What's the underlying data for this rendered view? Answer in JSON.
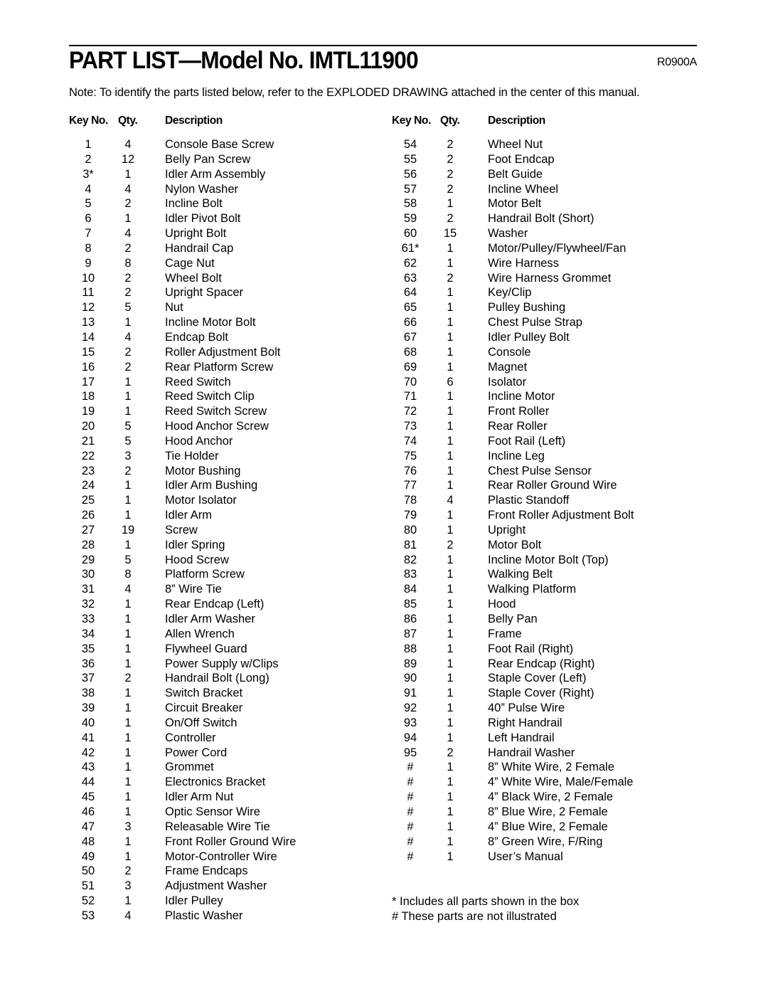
{
  "header": {
    "title": "PART LIST—Model No. IMTL11900",
    "code": "R0900A",
    "note": "Note: To identify the parts listed below, refer to the EXPLODED DRAWING attached in the center of this manual."
  },
  "columns": {
    "key": "Key No.",
    "qty": "Qty.",
    "desc": "Description"
  },
  "left_parts": [
    {
      "key": "1",
      "qty": "4",
      "desc": "Console Base Screw"
    },
    {
      "key": "2",
      "qty": "12",
      "desc": "Belly Pan Screw"
    },
    {
      "key": "3*",
      "qty": "1",
      "desc": "Idler Arm Assembly"
    },
    {
      "key": "4",
      "qty": "4",
      "desc": "Nylon Washer"
    },
    {
      "key": "5",
      "qty": "2",
      "desc": "Incline Bolt"
    },
    {
      "key": "6",
      "qty": "1",
      "desc": "Idler Pivot Bolt"
    },
    {
      "key": "7",
      "qty": "4",
      "desc": "Upright Bolt"
    },
    {
      "key": "8",
      "qty": "2",
      "desc": "Handrail Cap"
    },
    {
      "key": "9",
      "qty": "8",
      "desc": "Cage Nut"
    },
    {
      "key": "10",
      "qty": "2",
      "desc": "Wheel Bolt"
    },
    {
      "key": "11",
      "qty": "2",
      "desc": "Upright Spacer"
    },
    {
      "key": "12",
      "qty": "5",
      "desc": "Nut"
    },
    {
      "key": "13",
      "qty": "1",
      "desc": "Incline Motor Bolt"
    },
    {
      "key": "14",
      "qty": "4",
      "desc": "Endcap Bolt"
    },
    {
      "key": "15",
      "qty": "2",
      "desc": "Roller Adjustment Bolt"
    },
    {
      "key": "16",
      "qty": "2",
      "desc": "Rear Platform Screw"
    },
    {
      "key": "17",
      "qty": "1",
      "desc": "Reed Switch"
    },
    {
      "key": "18",
      "qty": "1",
      "desc": "Reed Switch Clip"
    },
    {
      "key": "19",
      "qty": "1",
      "desc": "Reed Switch Screw"
    },
    {
      "key": "20",
      "qty": "5",
      "desc": "Hood Anchor Screw"
    },
    {
      "key": "21",
      "qty": "5",
      "desc": "Hood Anchor"
    },
    {
      "key": "22",
      "qty": "3",
      "desc": "Tie Holder"
    },
    {
      "key": "23",
      "qty": "2",
      "desc": "Motor Bushing"
    },
    {
      "key": "24",
      "qty": "1",
      "desc": "Idler Arm Bushing"
    },
    {
      "key": "25",
      "qty": "1",
      "desc": "Motor Isolator"
    },
    {
      "key": "26",
      "qty": "1",
      "desc": "Idler Arm"
    },
    {
      "key": "27",
      "qty": "19",
      "desc": "Screw"
    },
    {
      "key": "28",
      "qty": "1",
      "desc": "Idler Spring"
    },
    {
      "key": "29",
      "qty": "5",
      "desc": "Hood Screw"
    },
    {
      "key": "30",
      "qty": "8",
      "desc": "Platform Screw"
    },
    {
      "key": "31",
      "qty": "4",
      "desc": "8” Wire Tie"
    },
    {
      "key": "32",
      "qty": "1",
      "desc": "Rear Endcap (Left)"
    },
    {
      "key": "33",
      "qty": "1",
      "desc": "Idler Arm Washer"
    },
    {
      "key": "34",
      "qty": "1",
      "desc": "Allen Wrench"
    },
    {
      "key": "35",
      "qty": "1",
      "desc": "Flywheel Guard"
    },
    {
      "key": "36",
      "qty": "1",
      "desc": "Power Supply w/Clips"
    },
    {
      "key": "37",
      "qty": "2",
      "desc": "Handrail Bolt (Long)"
    },
    {
      "key": "38",
      "qty": "1",
      "desc": "Switch Bracket"
    },
    {
      "key": "39",
      "qty": "1",
      "desc": "Circuit Breaker"
    },
    {
      "key": "40",
      "qty": "1",
      "desc": "On/Off Switch"
    },
    {
      "key": "41",
      "qty": "1",
      "desc": "Controller"
    },
    {
      "key": "42",
      "qty": "1",
      "desc": "Power Cord"
    },
    {
      "key": "43",
      "qty": "1",
      "desc": "Grommet"
    },
    {
      "key": "44",
      "qty": "1",
      "desc": "Electronics Bracket"
    },
    {
      "key": "45",
      "qty": "1",
      "desc": "Idler Arm Nut"
    },
    {
      "key": "46",
      "qty": "1",
      "desc": "Optic Sensor Wire"
    },
    {
      "key": "47",
      "qty": "3",
      "desc": "Releasable Wire Tie"
    },
    {
      "key": "48",
      "qty": "1",
      "desc": "Front Roller Ground Wire"
    },
    {
      "key": "49",
      "qty": "1",
      "desc": "Motor-Controller Wire"
    },
    {
      "key": "50",
      "qty": "2",
      "desc": "Frame Endcaps"
    },
    {
      "key": "51",
      "qty": "3",
      "desc": "Adjustment Washer"
    },
    {
      "key": "52",
      "qty": "1",
      "desc": "Idler Pulley"
    },
    {
      "key": "53",
      "qty": "4",
      "desc": "Plastic Washer"
    }
  ],
  "right_parts": [
    {
      "key": "54",
      "qty": "2",
      "desc": "Wheel Nut"
    },
    {
      "key": "55",
      "qty": "2",
      "desc": "Foot Endcap"
    },
    {
      "key": "56",
      "qty": "2",
      "desc": "Belt Guide"
    },
    {
      "key": "57",
      "qty": "2",
      "desc": "Incline Wheel"
    },
    {
      "key": "58",
      "qty": "1",
      "desc": "Motor Belt"
    },
    {
      "key": "59",
      "qty": "2",
      "desc": "Handrail Bolt (Short)"
    },
    {
      "key": "60",
      "qty": "15",
      "desc": "Washer"
    },
    {
      "key": "61*",
      "qty": "1",
      "desc": "Motor/Pulley/Flywheel/Fan"
    },
    {
      "key": "62",
      "qty": "1",
      "desc": "Wire  Harness"
    },
    {
      "key": "63",
      "qty": "2",
      "desc": "Wire Harness Grommet"
    },
    {
      "key": "64",
      "qty": "1",
      "desc": "Key/Clip"
    },
    {
      "key": "65",
      "qty": "1",
      "desc": "Pulley Bushing"
    },
    {
      "key": "66",
      "qty": "1",
      "desc": "Chest Pulse Strap"
    },
    {
      "key": "67",
      "qty": "1",
      "desc": "Idler Pulley Bolt"
    },
    {
      "key": "68",
      "qty": "1",
      "desc": "Console"
    },
    {
      "key": "69",
      "qty": "1",
      "desc": "Magnet"
    },
    {
      "key": "70",
      "qty": "6",
      "desc": "Isolator"
    },
    {
      "key": "71",
      "qty": "1",
      "desc": "Incline Motor"
    },
    {
      "key": "72",
      "qty": "1",
      "desc": "Front Roller"
    },
    {
      "key": "73",
      "qty": "1",
      "desc": "Rear Roller"
    },
    {
      "key": "74",
      "qty": "1",
      "desc": "Foot Rail (Left)"
    },
    {
      "key": "75",
      "qty": "1",
      "desc": "Incline Leg"
    },
    {
      "key": "76",
      "qty": "1",
      "desc": "Chest Pulse Sensor"
    },
    {
      "key": "77",
      "qty": "1",
      "desc": "Rear Roller Ground Wire"
    },
    {
      "key": "78",
      "qty": "4",
      "desc": "Plastic Standoff"
    },
    {
      "key": "79",
      "qty": "1",
      "desc": "Front Roller Adjustment Bolt"
    },
    {
      "key": "80",
      "qty": "1",
      "desc": "Upright"
    },
    {
      "key": "81",
      "qty": "2",
      "desc": "Motor Bolt"
    },
    {
      "key": "82",
      "qty": "1",
      "desc": "Incline Motor Bolt (Top)"
    },
    {
      "key": "83",
      "qty": "1",
      "desc": "Walking Belt"
    },
    {
      "key": "84",
      "qty": "1",
      "desc": "Walking Platform"
    },
    {
      "key": "85",
      "qty": "1",
      "desc": "Hood"
    },
    {
      "key": "86",
      "qty": "1",
      "desc": "Belly Pan"
    },
    {
      "key": "87",
      "qty": "1",
      "desc": "Frame"
    },
    {
      "key": "88",
      "qty": "1",
      "desc": "Foot Rail (Right)"
    },
    {
      "key": "89",
      "qty": "1",
      "desc": "Rear Endcap (Right)"
    },
    {
      "key": "90",
      "qty": "1",
      "desc": "Staple Cover (Left)"
    },
    {
      "key": "91",
      "qty": "1",
      "desc": "Staple  Cover (Right)"
    },
    {
      "key": "92",
      "qty": "1",
      "desc": "40” Pulse Wire"
    },
    {
      "key": "93",
      "qty": "1",
      "desc": "Right Handrail"
    },
    {
      "key": "94",
      "qty": "1",
      "desc": "Left Handrail"
    },
    {
      "key": "95",
      "qty": "2",
      "desc": "Handrail Washer"
    },
    {
      "key": "#",
      "qty": "1",
      "desc": "8” White Wire, 2 Female"
    },
    {
      "key": "#",
      "qty": "1",
      "desc": "4” White Wire, Male/Female"
    },
    {
      "key": "#",
      "qty": "1",
      "desc": "4” Black Wire, 2 Female"
    },
    {
      "key": "#",
      "qty": "1",
      "desc": "8” Blue Wire, 2 Female"
    },
    {
      "key": "#",
      "qty": "1",
      "desc": "4” Blue Wire, 2 Female"
    },
    {
      "key": "#",
      "qty": "1",
      "desc": "8” Green Wire, F/Ring"
    },
    {
      "key": "#",
      "qty": "1",
      "desc": "User’s Manual"
    }
  ],
  "footnotes": {
    "asterisk": "* Includes all parts shown in the box",
    "hash": "# These parts are not illustrated"
  }
}
